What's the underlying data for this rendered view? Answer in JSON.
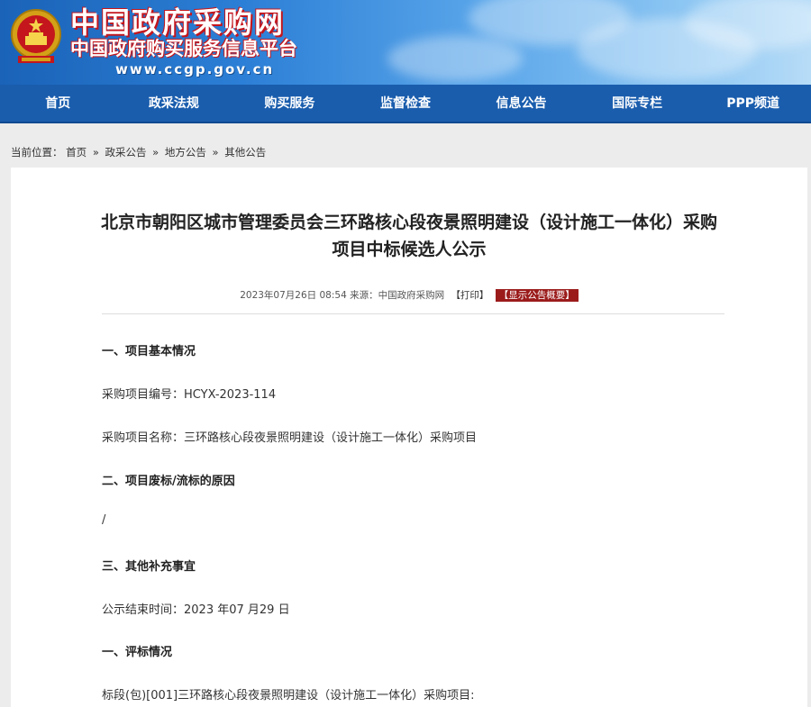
{
  "header": {
    "site_name": "中国政府采购网",
    "site_subtitle": "中国政府购买服务信息平台",
    "site_url": "www.ccgp.gov.cn"
  },
  "nav": {
    "items": [
      {
        "label": "首页"
      },
      {
        "label": "政采法规"
      },
      {
        "label": "购买服务"
      },
      {
        "label": "监督检查"
      },
      {
        "label": "信息公告"
      },
      {
        "label": "国际专栏"
      },
      {
        "label": "PPP频道"
      }
    ]
  },
  "breadcrumb": {
    "prefix": "当前位置：",
    "items": [
      "首页",
      "政采公告",
      "地方公告",
      "其他公告"
    ],
    "separator": "»"
  },
  "article": {
    "title_line1": "北京市朝阳区城市管理委员会三环路核心段夜景照明建设（设计施工一体化）采购",
    "title_line2": "项目中标候选人公示",
    "meta_text": "2023年07月26日 08:54 来源：中国政府采购网",
    "print_label": "【打印】",
    "summary_label": "【显示公告概要】",
    "lines": [
      {
        "text": "一、项目基本情况",
        "heading": true
      },
      {
        "text": "采购项目编号：HCYX-2023-114",
        "heading": false
      },
      {
        "text": "采购项目名称：三环路核心段夜景照明建设（设计施工一体化）采购项目",
        "heading": false
      },
      {
        "text": "二、项目废标/流标的原因",
        "heading": true
      },
      {
        "text": "/",
        "heading": false
      },
      {
        "text": "三、其他补充事宜",
        "heading": true
      },
      {
        "text": "公示结束时间：2023 年07 月29 日",
        "heading": false
      },
      {
        "text": "一、评标情况",
        "heading": true
      },
      {
        "text": "标段(包)[001]三环路核心段夜景照明建设（设计施工一体化）采购项目:",
        "heading": false
      }
    ]
  },
  "colors": {
    "nav_bg": "#1a5dad",
    "summary_badge": "#9b1b1b",
    "banner_red": "#c4161c"
  }
}
